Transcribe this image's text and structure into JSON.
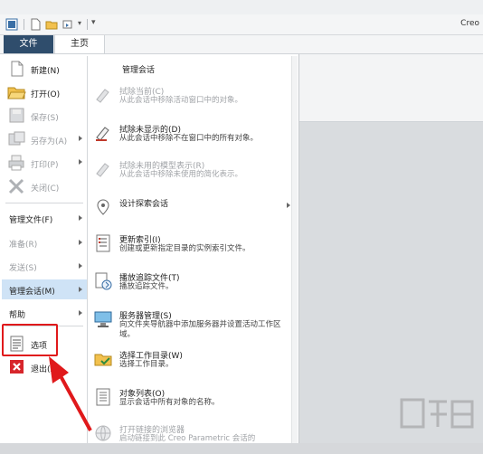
{
  "app": {
    "title": "Creo"
  },
  "tabs": {
    "file": "文件",
    "home": "主页"
  },
  "left_menu": {
    "items": [
      {
        "label": "新建(N)",
        "disabled": false,
        "has_arrow": false,
        "icon": "new-file-icon"
      },
      {
        "label": "打开(O)",
        "disabled": false,
        "has_arrow": false,
        "icon": "open-folder-icon"
      },
      {
        "label": "保存(S)",
        "disabled": true,
        "has_arrow": false,
        "icon": "save-icon"
      },
      {
        "label": "另存为(A)",
        "disabled": true,
        "has_arrow": true,
        "icon": "save-as-icon"
      },
      {
        "label": "打印(P)",
        "disabled": true,
        "has_arrow": true,
        "icon": "print-icon"
      },
      {
        "label": "关闭(C)",
        "disabled": true,
        "has_arrow": false,
        "icon": "close-icon"
      }
    ],
    "sections": [
      {
        "label": "管理文件(F)",
        "disabled": false,
        "active": false
      },
      {
        "label": "准备(R)",
        "disabled": true,
        "active": false
      },
      {
        "label": "发送(S)",
        "disabled": true,
        "active": false
      },
      {
        "label": "管理会话(M)",
        "disabled": false,
        "active": true
      },
      {
        "label": "帮助",
        "disabled": false,
        "active": false
      }
    ],
    "bottom": [
      {
        "label": "选项",
        "icon": "options-icon"
      },
      {
        "label": "退出(X)",
        "icon": "exit-icon"
      }
    ]
  },
  "submenu": {
    "heading": "管理会话",
    "items": [
      {
        "title": "拭除当前(C)",
        "desc": "从此会话中移除活动窗口中的对象。",
        "disabled": true,
        "icon": "erase-current-icon"
      },
      {
        "title": "拭除未显示的(D)",
        "desc": "从此会话中移除不在窗口中的所有对象。",
        "disabled": false,
        "icon": "erase-not-displayed-icon"
      },
      {
        "title": "拭除未用的模型表示(R)",
        "desc": "从此会话中移除未使用的简化表示。",
        "disabled": true,
        "icon": "erase-unused-reps-icon"
      },
      {
        "title": "设计探索会话",
        "desc": "",
        "disabled": false,
        "has_arrow": true,
        "icon": "design-exploration-icon"
      },
      {
        "title": "更新索引(I)",
        "desc": "创建或更新指定目录的实例索引文件。",
        "disabled": false,
        "icon": "update-index-icon"
      },
      {
        "title": "播放追踪文件(T)",
        "desc": "播放追踪文件。",
        "disabled": false,
        "icon": "play-trail-icon"
      },
      {
        "title": "服务器管理(S)",
        "desc": "向文件夹导航器中添加服务器并设置活动工作区域。",
        "disabled": false,
        "icon": "server-management-icon"
      },
      {
        "title": "选择工作目录(W)",
        "desc": "选择工作目录。",
        "disabled": false,
        "icon": "working-directory-icon"
      },
      {
        "title": "对象列表(O)",
        "desc": "显示会话中所有对象的名称。",
        "disabled": false,
        "icon": "object-list-icon"
      },
      {
        "title": "打开链接的浏览器",
        "desc": "启动链接到此 Creo Parametric 会话的",
        "disabled": true,
        "icon": "linked-browser-icon"
      }
    ]
  },
  "colors": {
    "file_tab": "#2f4d6c",
    "active_section": "#cfe3f6",
    "highlight": "#e0191b"
  }
}
